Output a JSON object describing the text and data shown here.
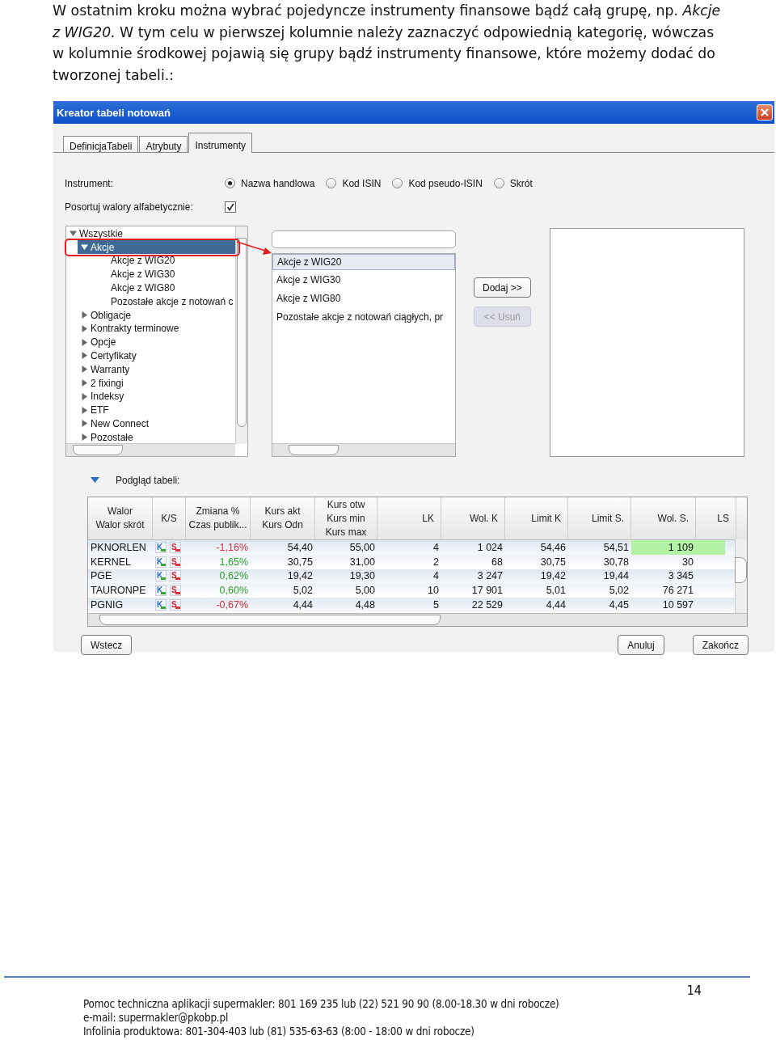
{
  "intro": "W ostatnim kroku można wybrać pojedyncze instrumenty finansowe bądź całą grupę, np. *Akcje z WIG20.* W tym celu w pierwszej kolumnie należy zaznaczyć odpowiednią kategorię, wówczas w kolumnie środkowej pojawią się grupy bądź instrumenty finansowe, które możemy dodać do tworzonej tabeli.:",
  "window": {
    "title": "Kreator tabeli notowań"
  },
  "tabs": [
    {
      "label": "DefinicjaTabeli",
      "selected": false
    },
    {
      "label": "Atrybuty",
      "selected": false
    },
    {
      "label": "Instrumenty",
      "selected": true
    }
  ],
  "instrument": {
    "label": "Instrument:",
    "options": [
      {
        "label": "Nazwa handlowa",
        "selected": true
      },
      {
        "label": "Kod ISIN",
        "selected": false
      },
      {
        "label": "Kod pseudo-ISIN",
        "selected": false
      },
      {
        "label": "Skrót",
        "selected": false
      }
    ]
  },
  "sort": {
    "label": "Posortuj walory alfabetycznie:",
    "checked": true
  },
  "tree": [
    {
      "label": "Wszystkie",
      "expanded": true,
      "selected": false,
      "children": [
        {
          "label": "Akcje",
          "expanded": true,
          "selected": true,
          "children": [
            {
              "label": "Akcje z WIG20",
              "selected": false
            },
            {
              "label": "Akcje z WIG30",
              "selected": false
            },
            {
              "label": "Akcje z WIG80",
              "selected": false
            },
            {
              "label": "Pozostałe akcje z notowań c",
              "selected": false
            }
          ]
        },
        {
          "label": "Obligacje",
          "expanded": false,
          "selected": false
        },
        {
          "label": "Kontrakty terminowe",
          "expanded": false,
          "selected": false
        },
        {
          "label": "Opcje",
          "expanded": false,
          "selected": false
        },
        {
          "label": "Certyfikaty",
          "expanded": false,
          "selected": false
        },
        {
          "label": "Warranty",
          "expanded": false,
          "selected": false
        },
        {
          "label": "2 fixingi",
          "expanded": false,
          "selected": false
        },
        {
          "label": "Indeksy",
          "expanded": false,
          "selected": false
        },
        {
          "label": "ETF",
          "expanded": false,
          "selected": false
        },
        {
          "label": "New Connect",
          "expanded": false,
          "selected": false
        },
        {
          "label": "Pozostałe",
          "expanded": false,
          "selected": false
        }
      ]
    }
  ],
  "group_list": [
    {
      "label": "Akcje z WIG20",
      "selected": true
    },
    {
      "label": "Akcje z WIG30",
      "selected": false
    },
    {
      "label": "Akcje z WIG80",
      "selected": false
    },
    {
      "label": "Pozostałe akcje z notowań ciągłych, pr",
      "selected": false
    }
  ],
  "move_buttons": [
    {
      "label": "Dodaj >>",
      "disabled": false
    },
    {
      "label": "<< Usuń",
      "disabled": true
    }
  ],
  "preview": {
    "label": "Podgląd tabeli:",
    "expanded": true
  },
  "table": {
    "columns": [
      {
        "lines": [
          "Walor",
          "Walor skrót"
        ]
      },
      {
        "lines": [
          "K/S"
        ]
      },
      {
        "lines": [
          "Zmiana %",
          "Czas publik..."
        ]
      },
      {
        "lines": [
          "Kurs akt",
          "Kurs Odn"
        ]
      },
      {
        "lines": [
          "Kurs otw",
          "Kurs min",
          "Kurs max"
        ]
      },
      {
        "lines": [
          "LK"
        ]
      },
      {
        "lines": [
          "Wol. K"
        ]
      },
      {
        "lines": [
          "Limit K"
        ]
      },
      {
        "lines": [
          "Limit S."
        ]
      },
      {
        "lines": [
          "Wol. S."
        ]
      },
      {
        "lines": [
          "LS"
        ]
      }
    ],
    "rows": [
      {
        "buy": "K",
        "sell": "S",
        "color": "#d0303a",
        "highlight": true,
        "cells": [
          "PKNORLEN",
          "",
          "-1,16%",
          "54,40",
          "55,00",
          "4",
          "1 024",
          "54,46",
          "54,51",
          "1 109",
          ""
        ]
      },
      {
        "buy": "K",
        "sell": "S",
        "color": "#2aa02a",
        "highlight": false,
        "cells": [
          "KERNEL",
          "",
          "1,65%",
          "30,75",
          "31,00",
          "2",
          "68",
          "30,75",
          "30,78",
          "30",
          ""
        ]
      },
      {
        "buy": "K",
        "sell": "S",
        "color": "#2aa02a",
        "highlight": false,
        "cells": [
          "PGE",
          "",
          "0,62%",
          "19,42",
          "19,30",
          "4",
          "3 247",
          "19,42",
          "19,44",
          "3 345",
          ""
        ]
      },
      {
        "buy": "K",
        "sell": "S",
        "color": "#2aa02a",
        "highlight": false,
        "cells": [
          "TAURONPE",
          "",
          "0,60%",
          "5,02",
          "5,00",
          "10",
          "17 901",
          "5,01",
          "5,02",
          "76 271",
          ""
        ]
      },
      {
        "buy": "K",
        "sell": "S",
        "color": "#d0303a",
        "highlight": false,
        "cells": [
          "PGNIG",
          "",
          "-0,67%",
          "4,44",
          "4,48",
          "5",
          "22 529",
          "4,44",
          "4,45",
          "10 597",
          ""
        ]
      }
    ]
  },
  "footer_buttons": [
    {
      "label": "Wstecz"
    },
    {
      "label": "Anuluj"
    },
    {
      "label": "Zakończ"
    }
  ],
  "page_number": "14",
  "footer_lines": [
    "Pomoc techniczna aplikacji supermakler: 801 169 235 lub (22) 521 90 90 (8.00-18.30 w dni robocze)",
    "e-mail: supermakler@pkobp.pl",
    "Infolinia produktowa: 801-304-403 lub (81) 535-63-63 (8:00 - 18:00 w dni robocze)"
  ]
}
